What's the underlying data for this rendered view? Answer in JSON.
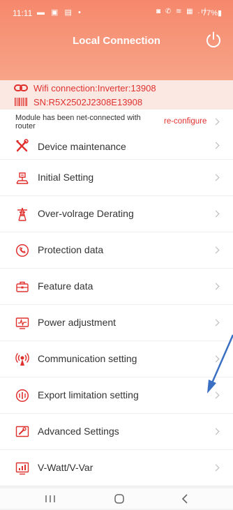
{
  "status_bar": {
    "time": "11:11",
    "notification_icons": "▬ ▣ ▤ •",
    "system_icons": "◙ ✆ ≋ ▦ .ıl",
    "battery": "77%▮"
  },
  "header": {
    "title": "Local Connection"
  },
  "connection": {
    "wifi_text": "Wifi connection:Inverter:13908",
    "sn_text": "SN:R5X2502J2308E13908"
  },
  "module": {
    "status_text": "Module has been net-connected with router",
    "reconfigure_label": "re-configure"
  },
  "menu": {
    "items": [
      {
        "label": "Device maintenance",
        "icon": "wrench-screwdriver-icon"
      },
      {
        "label": "Initial Setting",
        "icon": "initial-setting-icon"
      },
      {
        "label": "Over-volrage Derating",
        "icon": "tower-icon"
      },
      {
        "label": "Protection data",
        "icon": "protection-icon"
      },
      {
        "label": "Feature data",
        "icon": "briefcase-icon"
      },
      {
        "label": "Power adjustment",
        "icon": "power-adjust-icon"
      },
      {
        "label": "Communication setting",
        "icon": "antenna-icon"
      },
      {
        "label": "Export limitation setting",
        "icon": "export-limit-icon"
      },
      {
        "label": "Advanced Settings",
        "icon": "advanced-settings-icon"
      },
      {
        "label": "V-Watt/V-Var",
        "icon": "v-watt-chart-icon"
      }
    ]
  },
  "colors": {
    "accent_red": "#e0302e",
    "header_top": "#f6886c",
    "header_bottom": "#f7a488",
    "annotation_arrow": "#3b6fc4"
  }
}
